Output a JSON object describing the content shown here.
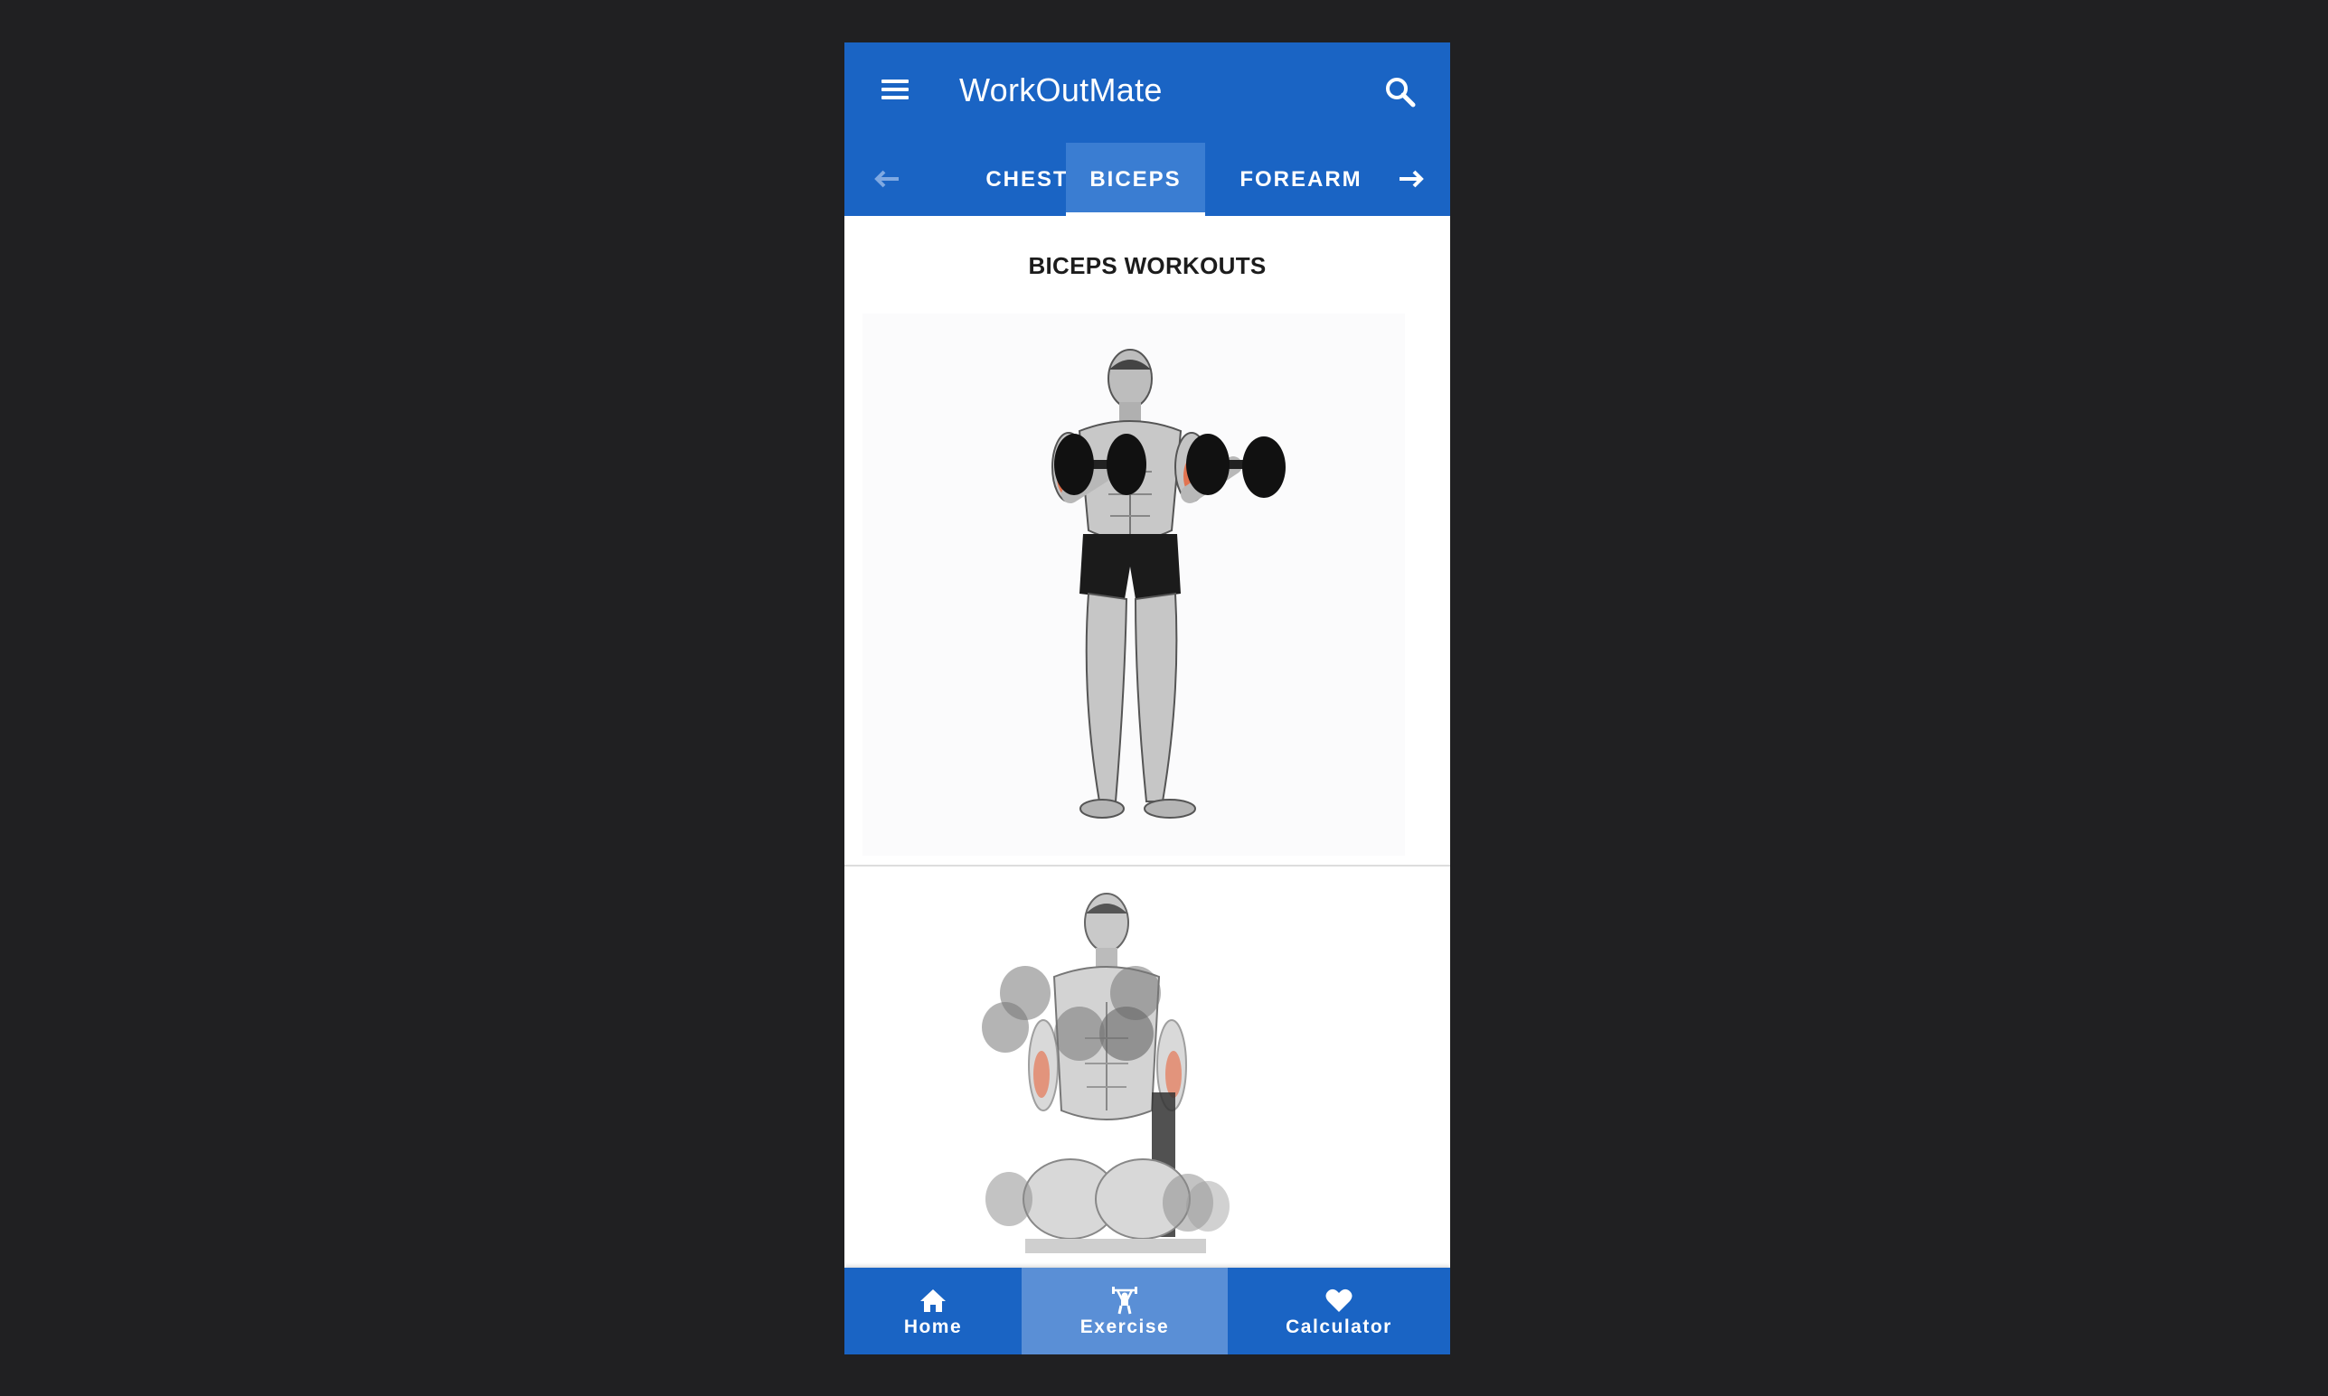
{
  "app": {
    "title": "WorkOutMate"
  },
  "tabs": {
    "items": [
      {
        "label": "CHEST",
        "active": false
      },
      {
        "label": "BICEPS",
        "active": true
      },
      {
        "label": "FOREARM",
        "active": false
      }
    ],
    "prev_icon": "arrow-left-icon",
    "next_icon": "arrow-right-icon"
  },
  "content": {
    "section_title": "BICEPS WORKOUTS",
    "cards": [
      {
        "illustration": "standing-dumbbell-curl-illustration"
      },
      {
        "illustration": "seated-dumbbell-curl-illustration"
      }
    ]
  },
  "bottom_nav": {
    "items": [
      {
        "label": "Home",
        "icon": "home-icon",
        "active": false
      },
      {
        "label": "Exercise",
        "icon": "weightlifter-icon",
        "active": true
      },
      {
        "label": "Calculator",
        "icon": "heart-icon",
        "active": false
      }
    ]
  },
  "colors": {
    "primary": "#1a64c4",
    "active_tab": "#3a7dd2",
    "active_nav": "#5a8fd6",
    "background": "#202022",
    "muscle_highlight": "#e8663d"
  }
}
